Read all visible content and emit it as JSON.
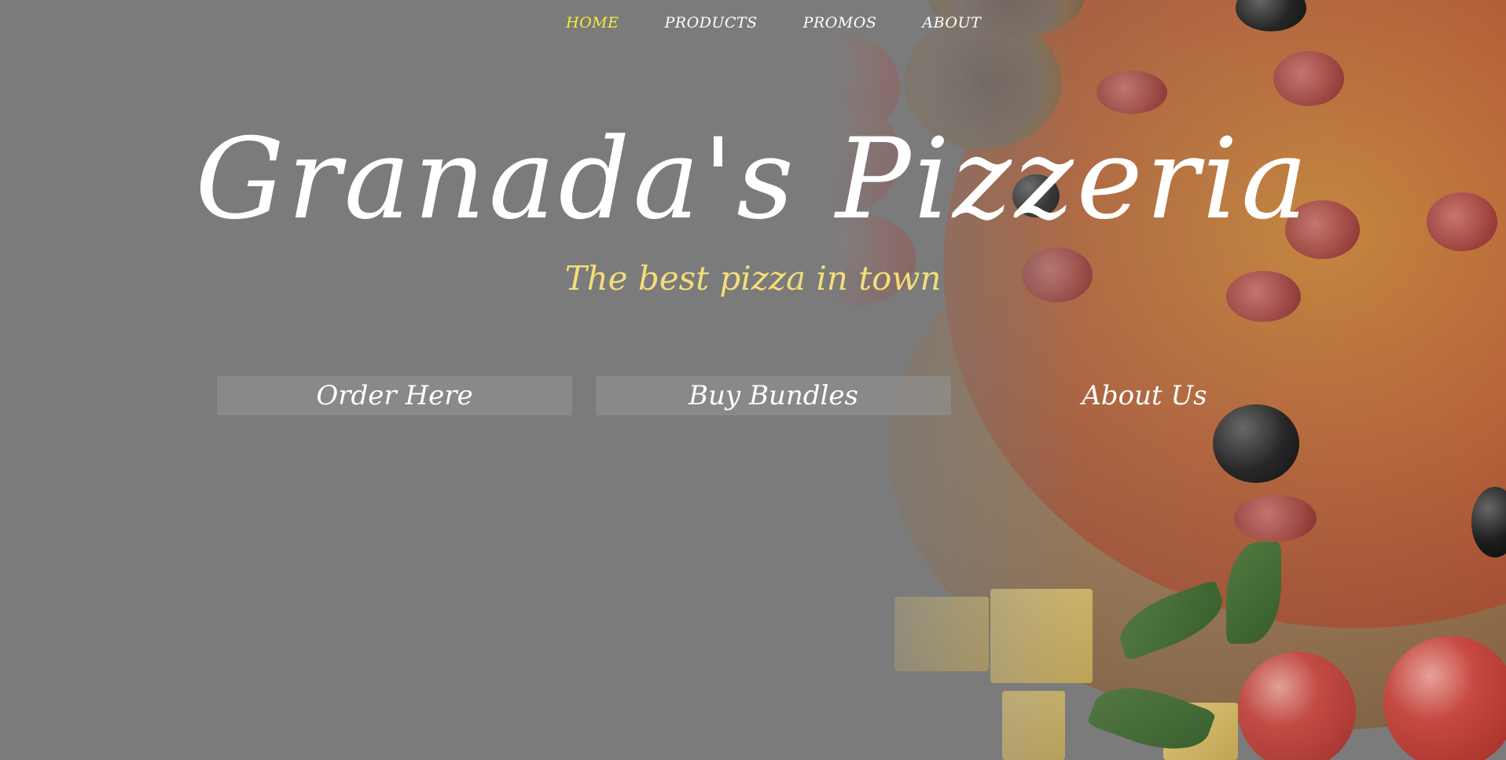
{
  "nav": {
    "items": [
      {
        "label": "HOME",
        "active": true
      },
      {
        "label": "PRODUCTS",
        "active": false
      },
      {
        "label": "PROMOS",
        "active": false
      },
      {
        "label": "ABOUT",
        "active": false
      }
    ]
  },
  "hero": {
    "title": "Granada's Pizzeria",
    "subtitle": "The best pizza in town"
  },
  "buttons": {
    "order": "Order Here",
    "bundles": "Buy Bundles",
    "about": "About Us"
  },
  "colors": {
    "overlay": "#7b7b7b",
    "nav_active": "#f3ec3b",
    "subtitle": "#f3dd7b",
    "text": "#ffffff"
  }
}
